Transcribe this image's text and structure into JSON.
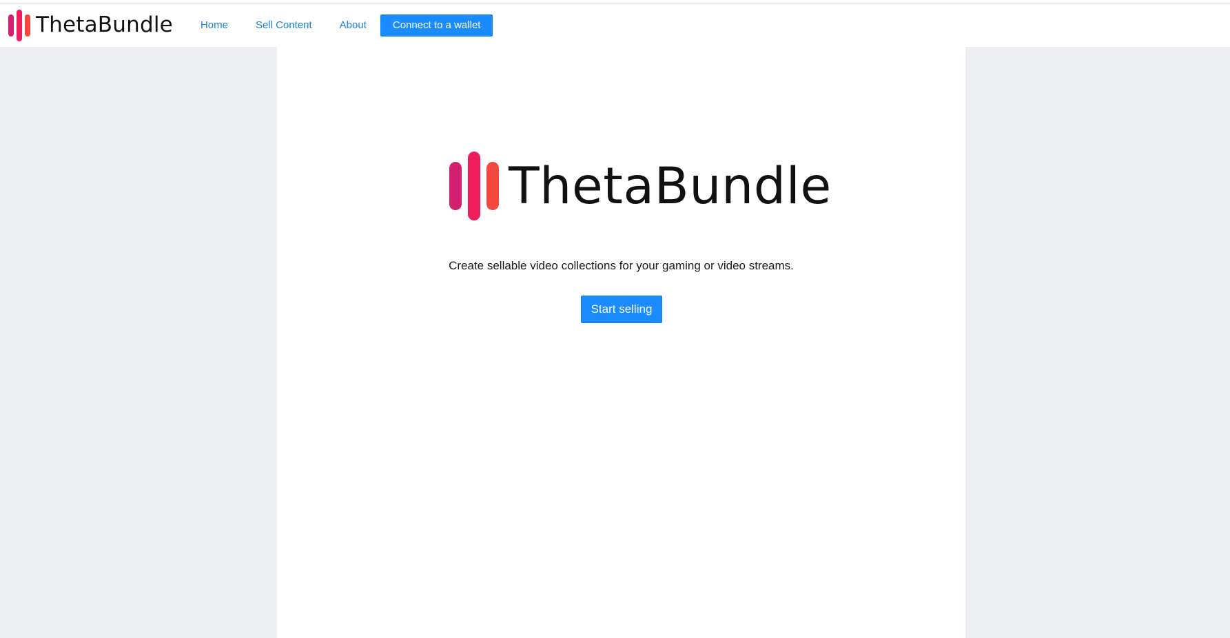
{
  "brand": {
    "name": "ThetaBundle",
    "logo_icon": "equalizer-bars-icon",
    "colors": [
      "#d21f6e",
      "#ef1d5c",
      "#f2473f"
    ]
  },
  "nav": {
    "links": [
      "Home",
      "Sell Content",
      "About"
    ],
    "wallet_button": "Connect to a wallet"
  },
  "hero": {
    "title": "ThetaBundle",
    "tagline": "Create sellable video collections for your gaming or video streams.",
    "cta": "Start selling"
  },
  "colors": {
    "accent": "#1a8cff",
    "link": "#1a7fd8",
    "background": "#eceef1",
    "panel": "#ffffff"
  }
}
